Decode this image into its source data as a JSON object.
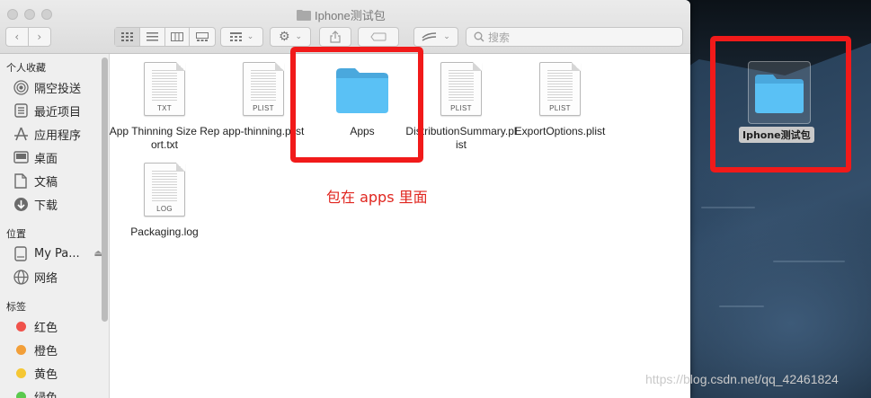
{
  "window": {
    "title": "Iphone测试包",
    "search_placeholder": "搜索"
  },
  "sidebar": {
    "favorites_header": "个人收藏",
    "favorites": [
      {
        "label": "隔空投送",
        "icon": "airdrop-icon"
      },
      {
        "label": "最近项目",
        "icon": "recents-icon"
      },
      {
        "label": "应用程序",
        "icon": "applications-icon"
      },
      {
        "label": "桌面",
        "icon": "desktop-icon"
      },
      {
        "label": "文稿",
        "icon": "documents-icon"
      },
      {
        "label": "下载",
        "icon": "downloads-icon"
      }
    ],
    "locations_header": "位置",
    "locations": [
      {
        "label": "My Pa...",
        "icon": "disk-icon"
      },
      {
        "label": "网络",
        "icon": "network-icon"
      }
    ],
    "tags_header": "标签",
    "tags": [
      {
        "label": "红色",
        "color": "#f0524b"
      },
      {
        "label": "橙色",
        "color": "#f29f39"
      },
      {
        "label": "黄色",
        "color": "#f5c734"
      },
      {
        "label": "绿色",
        "color": "#5bc94e"
      }
    ]
  },
  "files": [
    {
      "label": "App Thinning Size Report.txt",
      "ext": "TXT",
      "kind": "doc"
    },
    {
      "label": "app-thinning.plist",
      "ext": "PLIST",
      "kind": "doc"
    },
    {
      "label": "Apps",
      "ext": "",
      "kind": "folder"
    },
    {
      "label": "DistributionSummary.plist",
      "ext": "PLIST",
      "kind": "doc"
    },
    {
      "label": "ExportOptions.plist",
      "ext": "PLIST",
      "kind": "doc"
    },
    {
      "label": "Packaging.log",
      "ext": "LOG",
      "kind": "doc"
    }
  ],
  "annotation": "包在 apps 里面",
  "desktop": {
    "folder_label": "Iphone测试包"
  },
  "watermark": "https://blog.csdn.net/qq_42461824",
  "colors": {
    "annotation_red": "#f11a1a",
    "folder_blue": "#5ac1f5"
  }
}
